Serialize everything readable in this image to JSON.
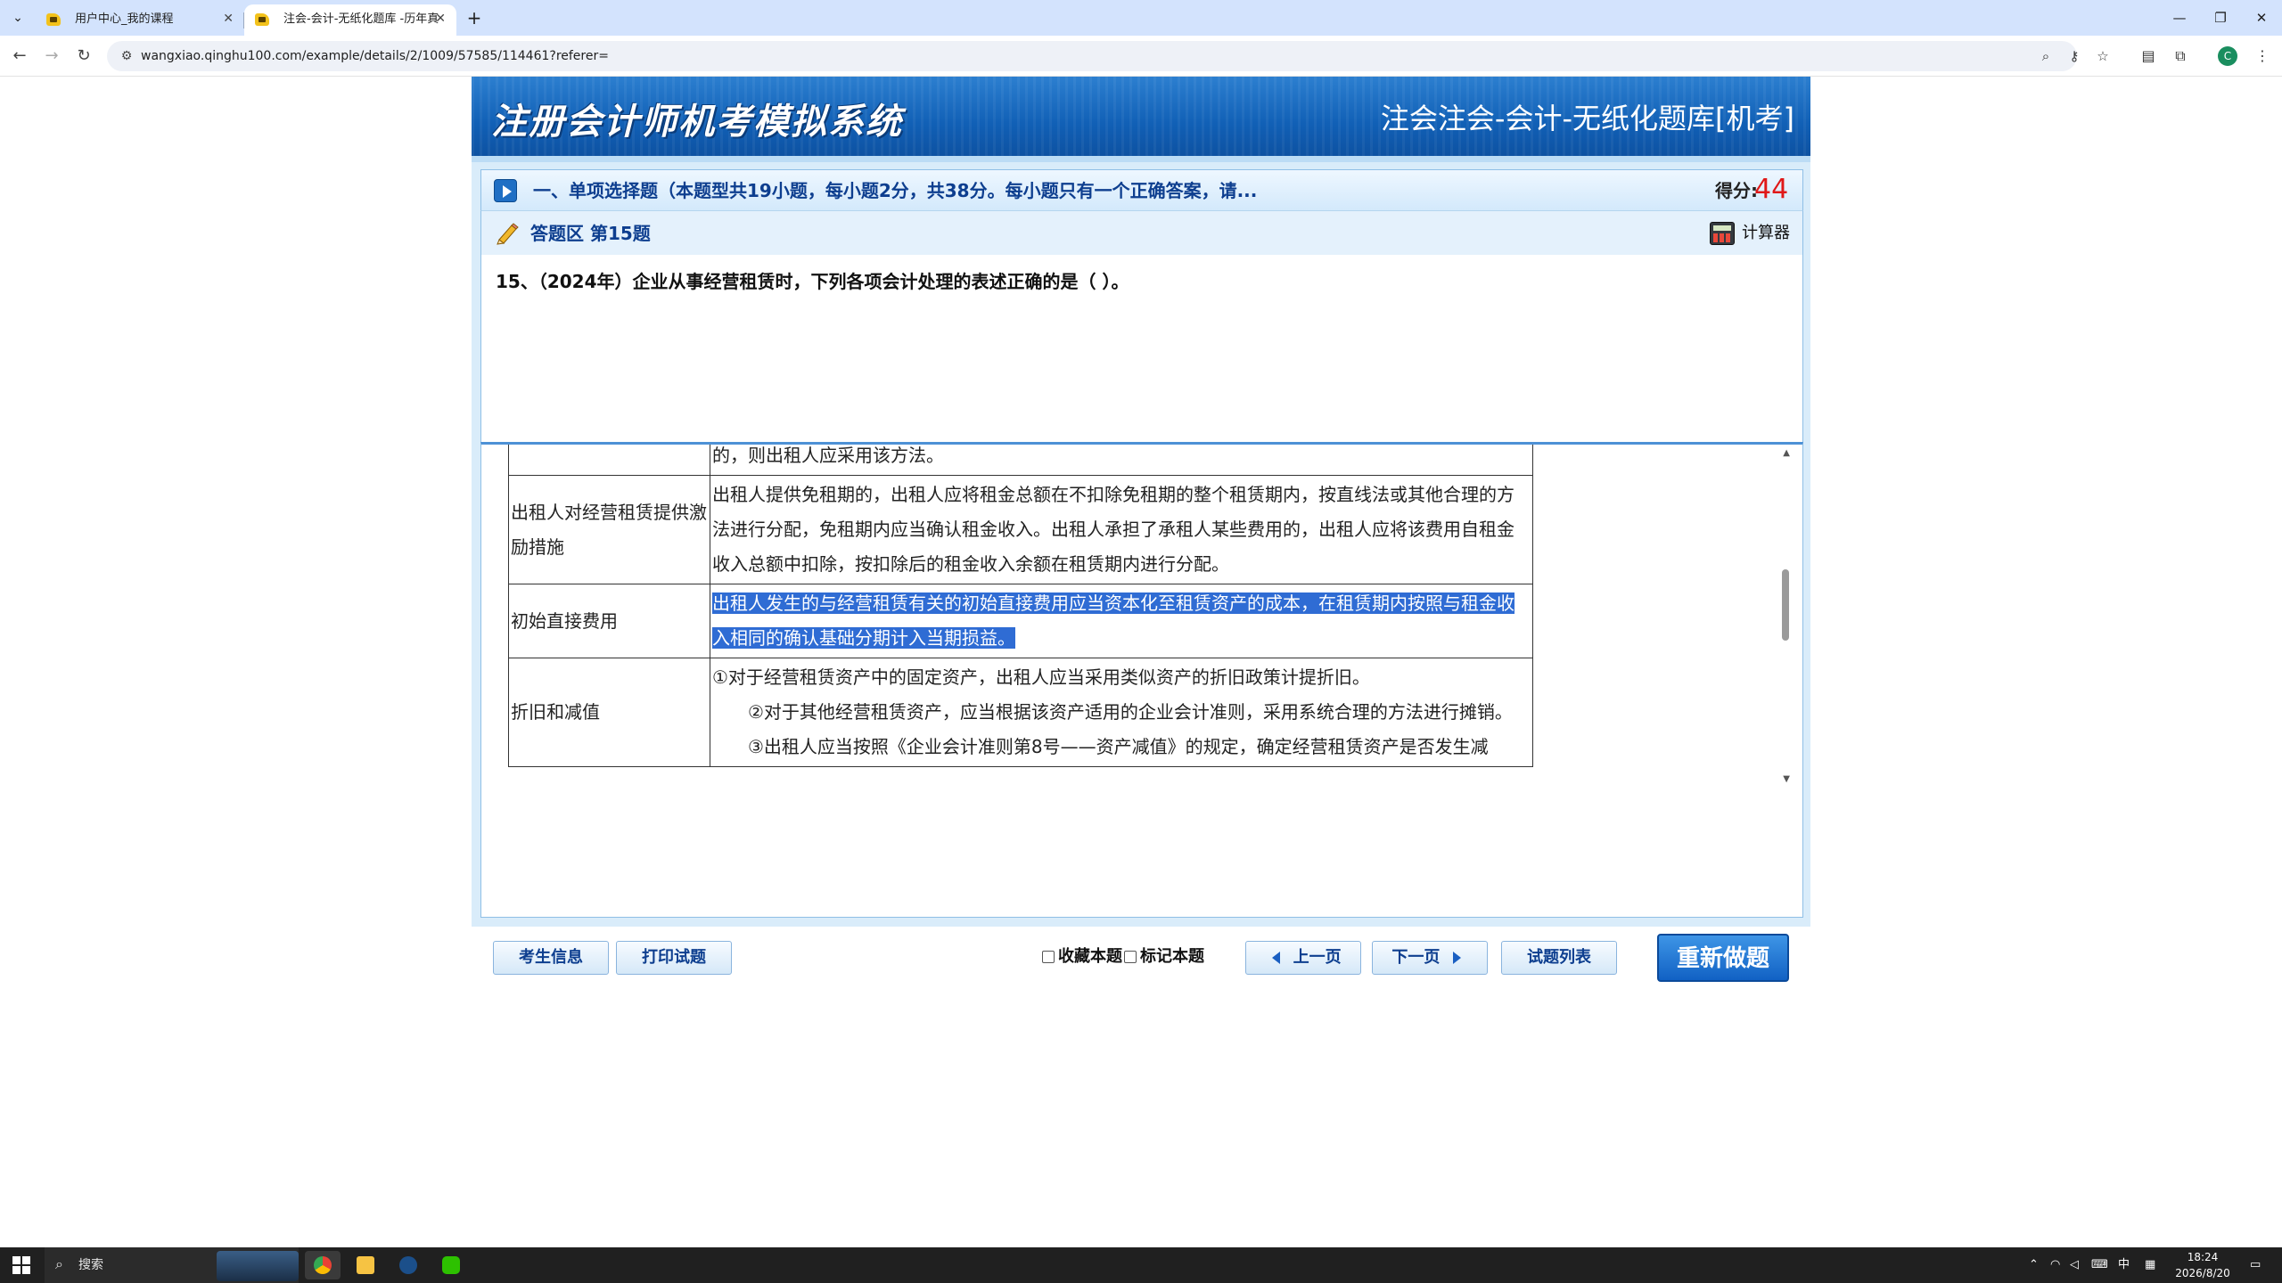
{
  "browser": {
    "tabs": [
      {
        "title": "用户中心_我的课程",
        "active": false
      },
      {
        "title": "注会-会计-无纸化题库 -历年真",
        "active": true
      }
    ],
    "url": "wangxiao.qinghu100.com/example/details/2/1009/57585/114461?referer=",
    "profile_initial": "C"
  },
  "app": {
    "system_title": "注册会计师机考模拟系统",
    "exam_name": "注会注会-会计-无纸化题库[机考]",
    "section_text": "一、单项选择题（本题型共19小题，每小题2分，共38分。每小题只有一个正确答案，请...",
    "score_label": "得分:",
    "score_value": "44",
    "answer_area_label": "答题区  第15题",
    "calculator_label": "计算器",
    "question": "15、（2024年）企业从事经营租赁时，下列各项会计处理的表述正确的是（    ）。",
    "explanation_rows": [
      {
        "item": "",
        "content": [
          "的，则出租人应采用该方法。"
        ]
      },
      {
        "item": "出租人对经营租赁提供激励措施",
        "content": [
          "出租人提供免租期的，出租人应将租金总额在不扣除免租期的整个租赁期内，按直线法或其他合理的方法进行分配，免租期内应当确认租金收入。出租人承担了承租人某些费用的，出租人应将该费用自租金收入总额中扣除，按扣除后的租金收入余额在租赁期内进行分配。"
        ]
      },
      {
        "item": "初始直接费用",
        "content": [
          "出租人发生的与经营租赁有关的初始直接费用应当资本化至租赁资产的成本，在租赁期内按照与租金收入相同的确认基础分期计入当期损益。"
        ]
      },
      {
        "item": "折旧和减值",
        "content": [
          "①对于经营租赁资产中的固定资产，出租人应当采用类似资产的折旧政策计提折旧。",
          "②对于其他经营租赁资产，应当根据该资产适用的企业会计准则，采用系统合理的方法进行摊销。",
          "③出租人应当按照《企业会计准则第8号——资产减值》的规定，确定经营租赁资产是否发生减"
        ]
      }
    ],
    "buttons": {
      "candidate_info": "考生信息",
      "print": "打印试题",
      "favorite": "收藏本题",
      "mark": "标记本题",
      "prev": "上一页",
      "next": "下一页",
      "question_list": "试题列表",
      "redo": "重新做题"
    }
  },
  "taskbar": {
    "search_label": "搜索",
    "ime": "中",
    "time": "18:24",
    "date": "2026/8/20"
  }
}
